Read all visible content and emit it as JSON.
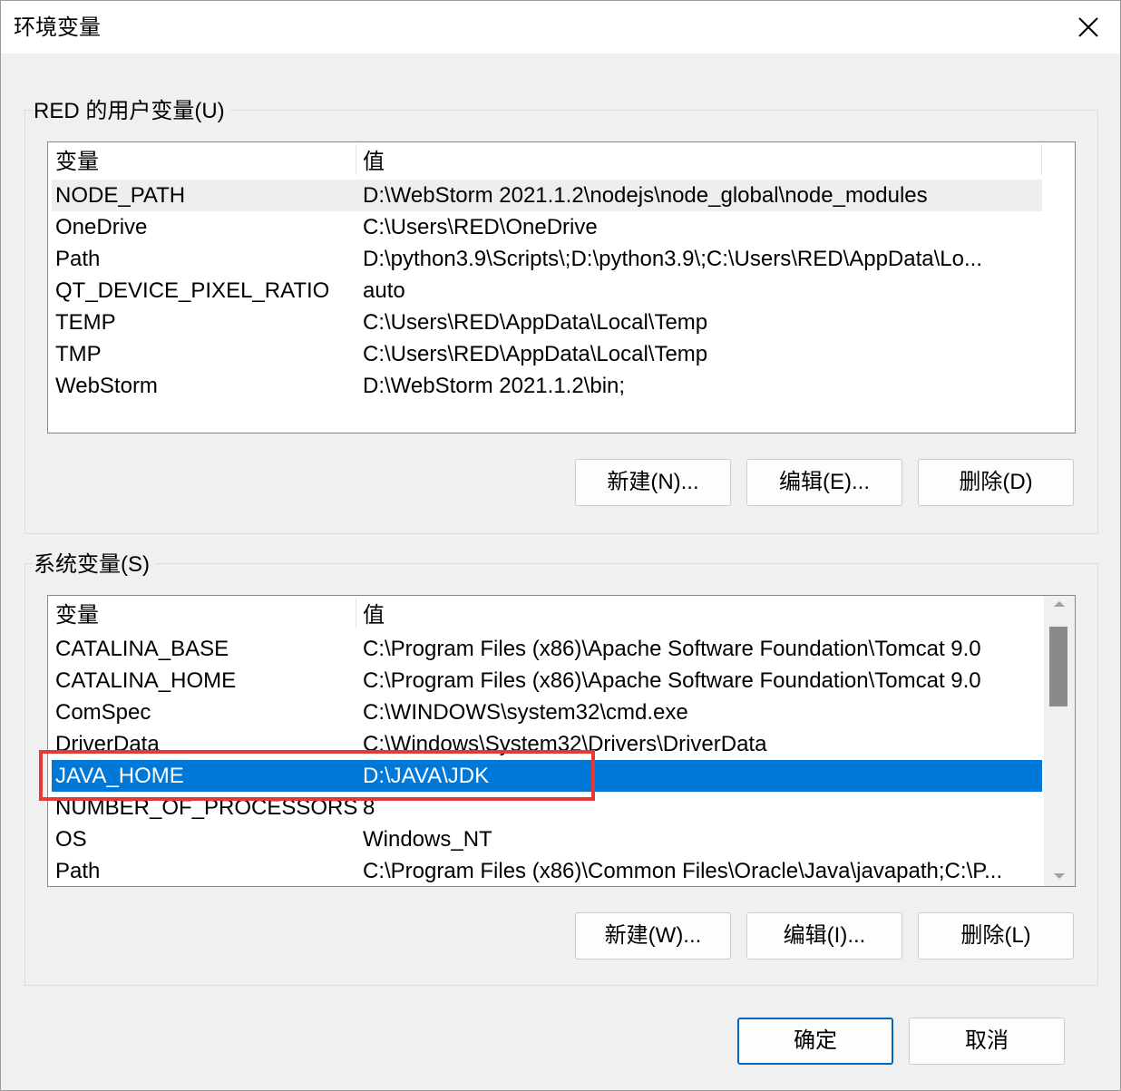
{
  "window": {
    "title": "环境变量"
  },
  "user_vars": {
    "group_label": "RED 的用户变量(U)",
    "columns": [
      "变量",
      "值"
    ],
    "rows": [
      {
        "name": "NODE_PATH",
        "value": "D:\\WebStorm 2021.1.2\\nodejs\\node_global\\node_modules"
      },
      {
        "name": "OneDrive",
        "value": "C:\\Users\\RED\\OneDrive"
      },
      {
        "name": "Path",
        "value": "D:\\python3.9\\Scripts\\;D:\\python3.9\\;C:\\Users\\RED\\AppData\\Lo..."
      },
      {
        "name": "QT_DEVICE_PIXEL_RATIO",
        "value": "auto"
      },
      {
        "name": "TEMP",
        "value": "C:\\Users\\RED\\AppData\\Local\\Temp"
      },
      {
        "name": "TMP",
        "value": "C:\\Users\\RED\\AppData\\Local\\Temp"
      },
      {
        "name": "WebStorm",
        "value": "D:\\WebStorm 2021.1.2\\bin;"
      }
    ],
    "buttons": {
      "new": "新建(N)...",
      "edit": "编辑(E)...",
      "delete": "删除(D)"
    }
  },
  "system_vars": {
    "group_label": "系统变量(S)",
    "columns": [
      "变量",
      "值"
    ],
    "rows": [
      {
        "name": "CATALINA_BASE",
        "value": "C:\\Program Files (x86)\\Apache Software Foundation\\Tomcat 9.0"
      },
      {
        "name": "CATALINA_HOME",
        "value": "C:\\Program Files (x86)\\Apache Software Foundation\\Tomcat 9.0"
      },
      {
        "name": "ComSpec",
        "value": "C:\\WINDOWS\\system32\\cmd.exe"
      },
      {
        "name": "DriverData",
        "value": "C:\\Windows\\System32\\Drivers\\DriverData"
      },
      {
        "name": "JAVA_HOME",
        "value": "D:\\JAVA\\JDK"
      },
      {
        "name": "NUMBER_OF_PROCESSORS",
        "value": "8"
      },
      {
        "name": "OS",
        "value": "Windows_NT"
      },
      {
        "name": "Path",
        "value": "C:\\Program Files (x86)\\Common Files\\Oracle\\Java\\javapath;C:\\P..."
      }
    ],
    "selected_row": "JAVA_HOME",
    "buttons": {
      "new": "新建(W)...",
      "edit": "编辑(I)...",
      "delete": "删除(L)"
    }
  },
  "footer": {
    "ok": "确定",
    "cancel": "取消"
  },
  "colors": {
    "selection": "#0078d7",
    "highlight_box": "#e53935",
    "default_button_border": "#0067c0"
  }
}
